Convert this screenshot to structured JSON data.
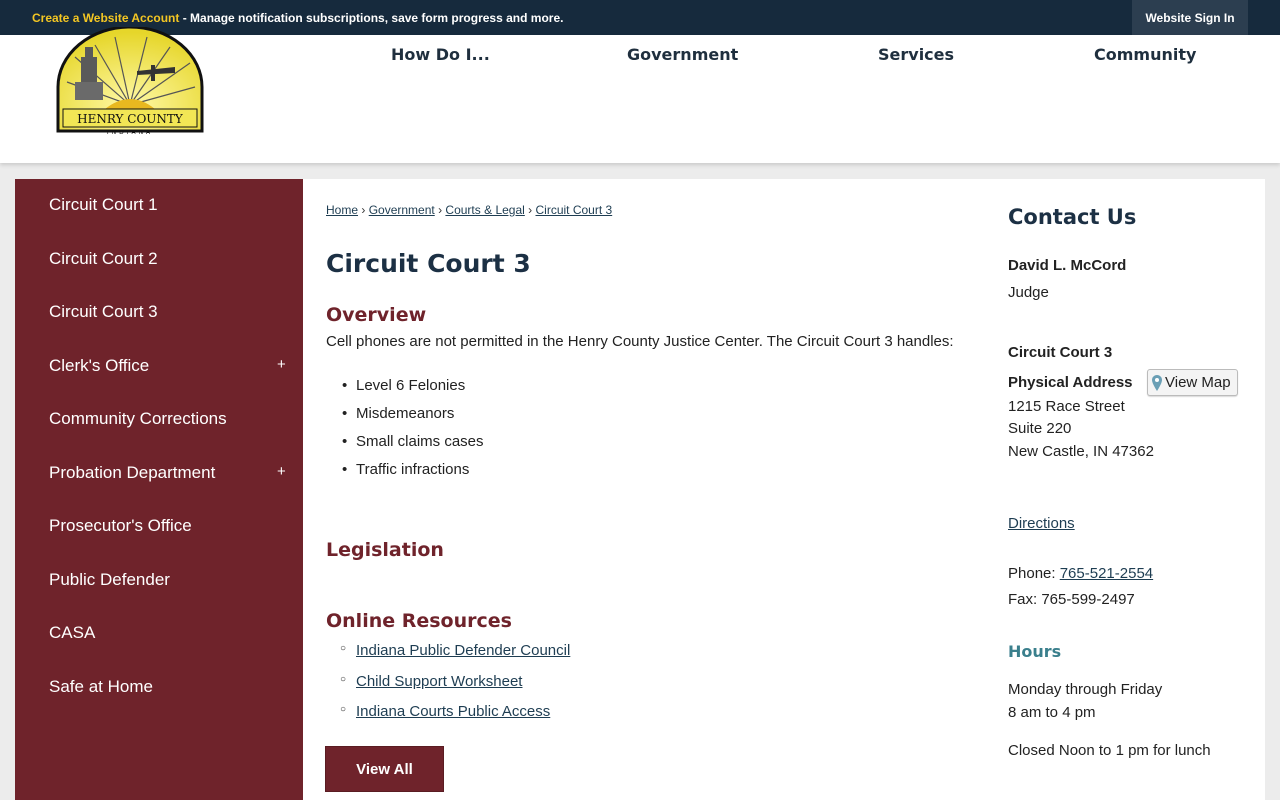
{
  "topbar": {
    "create_account": "Create a Website Account",
    "promo_text": " - Manage notification subscriptions, save form progress and more.",
    "signin": "Website Sign In"
  },
  "logo": {
    "name": "HENRY COUNTY",
    "sub": "INDIANA"
  },
  "nav": [
    {
      "label": "How Do I..."
    },
    {
      "label": "Government"
    },
    {
      "label": "Services"
    },
    {
      "label": "Community"
    }
  ],
  "sidebar": {
    "items": [
      {
        "label": "Circuit Court 1",
        "expandable": false
      },
      {
        "label": "Circuit Court 2",
        "expandable": false
      },
      {
        "label": "Circuit Court 3",
        "expandable": false
      },
      {
        "label": "Clerk's Office",
        "expandable": true
      },
      {
        "label": "Community Corrections",
        "expandable": false
      },
      {
        "label": "Probation Department",
        "expandable": true
      },
      {
        "label": "Prosecutor's Office",
        "expandable": false
      },
      {
        "label": "Public Defender",
        "expandable": false
      },
      {
        "label": "CASA",
        "expandable": false
      },
      {
        "label": "Safe at Home",
        "expandable": false
      }
    ],
    "plus_glyph": "+"
  },
  "breadcrumb": {
    "items": [
      "Home",
      "Government",
      "Courts & Legal",
      "Circuit Court 3"
    ],
    "separator": "›"
  },
  "main": {
    "title": "Circuit Court 3",
    "overview_heading": "Overview",
    "overview_text": "Cell phones are not permitted in the Henry County Justice Center. The Circuit Court 3 handles:",
    "handles": [
      "Level 6 Felonies",
      "Misdemeanors",
      "Small claims cases",
      "Traffic infractions"
    ],
    "legislation_heading": "Legislation",
    "resources_heading": "Online Resources",
    "resources": [
      "Indiana Public Defender Council",
      "Child Support Worksheet",
      "Indiana Courts Public Access"
    ],
    "view_all": "View All"
  },
  "contact": {
    "title": "Contact Us",
    "name": "David L. McCord",
    "role": "Judge",
    "dept": "Circuit Court 3",
    "address_label": "Physical Address",
    "view_map": "View Map",
    "address1": "1215 Race Street",
    "address2": "Suite 220",
    "address3": "New Castle, IN 47362",
    "directions": "Directions",
    "phone_label": "Phone: ",
    "phone": "765-521-2554",
    "fax": "Fax: 765-599-2497",
    "hours_heading": "Hours",
    "hours1": "Monday through Friday",
    "hours2": "8 am to 4 pm",
    "hours3": "Closed Noon to 1 pm for lunch"
  },
  "colors": {
    "topbar": "#162a3d",
    "accent": "#f3c623",
    "sidebar": "#6f232b",
    "heading": "#1c3044",
    "hours": "#3a7f8c"
  }
}
